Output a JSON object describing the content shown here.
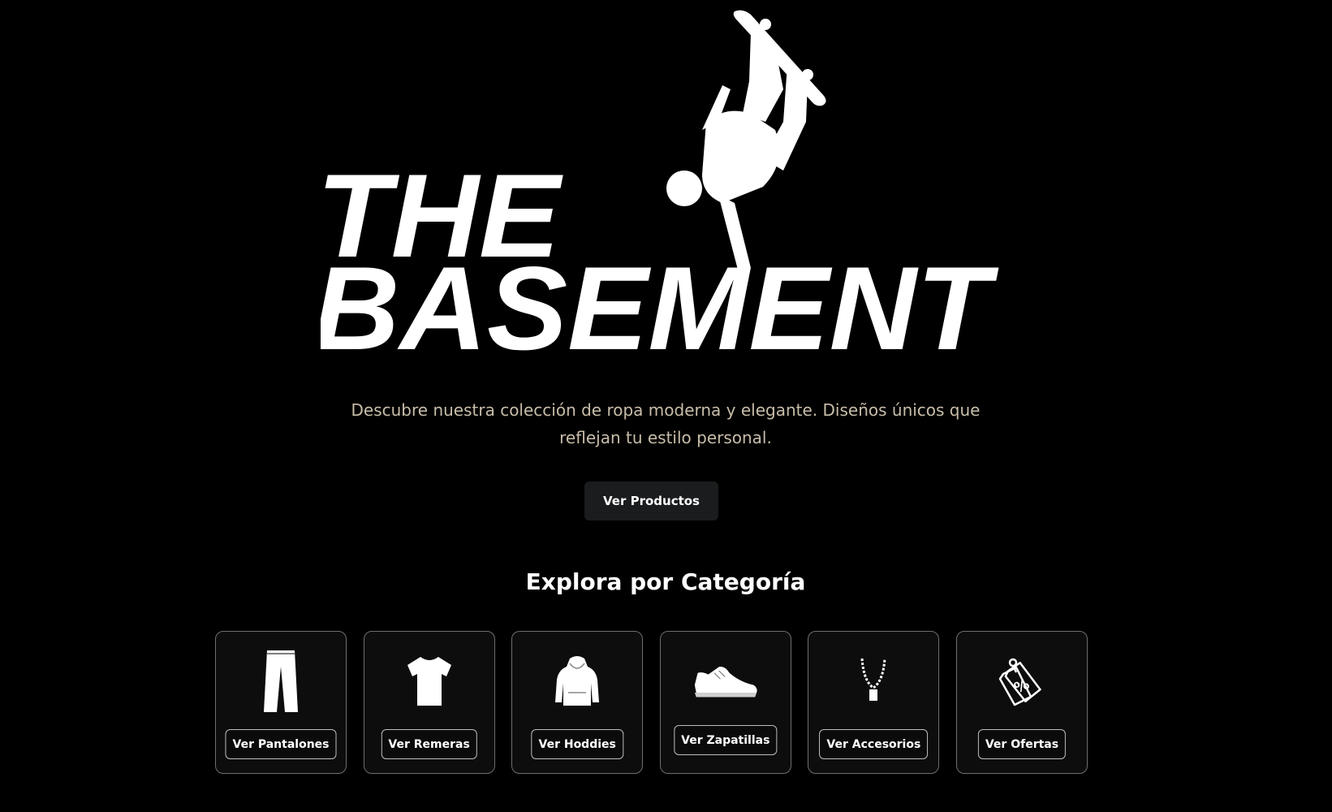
{
  "brand": {
    "line1": "THE",
    "line2": "BASEMENT",
    "logo_icon": "skateboarder-silhouette-icon"
  },
  "hero": {
    "tagline": "Descubre nuestra colección de ropa moderna y elegante. Diseños únicos que reflejan tu estilo personal.",
    "cta_label": "Ver Productos"
  },
  "categories": {
    "title": "Explora por Categoría",
    "items": [
      {
        "label": "Ver Pantalones",
        "icon": "pants-icon"
      },
      {
        "label": "Ver Remeras",
        "icon": "tshirt-icon"
      },
      {
        "label": "Ver Hoddies",
        "icon": "hoodie-icon"
      },
      {
        "label": "Ver Zapatillas",
        "icon": "sneaker-icon"
      },
      {
        "label": "Ver Accesorios",
        "icon": "necklace-icon"
      },
      {
        "label": "Ver Ofertas",
        "icon": "discount-tag-icon"
      }
    ]
  },
  "colors": {
    "background": "#000000",
    "text": "#ffffff",
    "tagline": "#c8bda9",
    "button_bg": "#1b1c1e",
    "card_border": "#6e6e6e"
  }
}
